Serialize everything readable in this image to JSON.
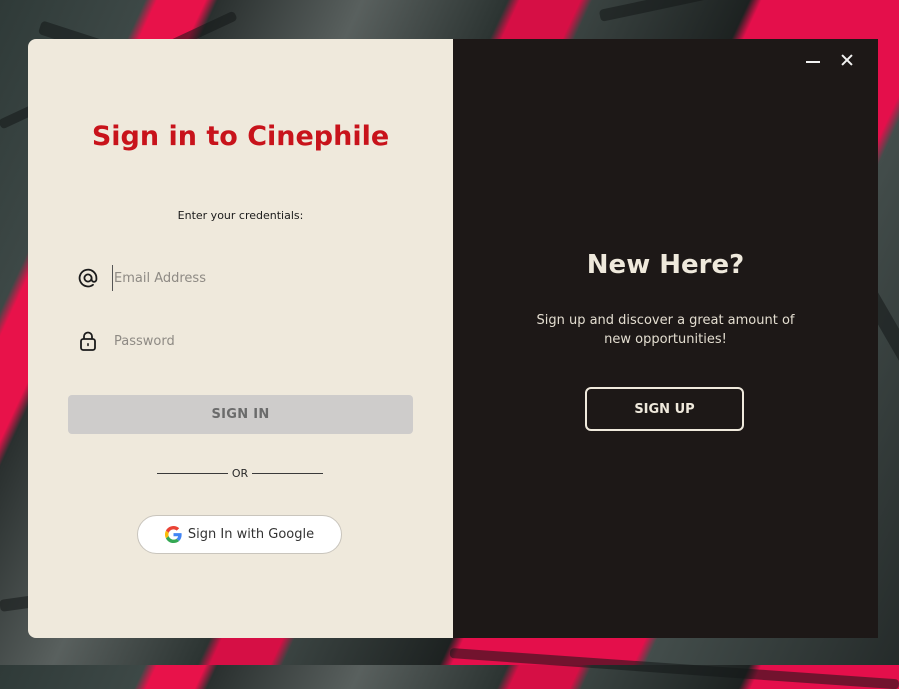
{
  "login": {
    "title": "Sign in to Cinephile",
    "subtitle": "Enter your credentials:",
    "email_placeholder": "Email Address",
    "password_placeholder": "Password",
    "email_icon": "at-icon",
    "password_icon": "lock-icon",
    "signin_label": "SIGN IN",
    "or_label": "OR",
    "google_label": "Sign In with Google",
    "google_icon": "google-icon"
  },
  "signup": {
    "title": "New Here?",
    "description": "Sign up and discover a great amount of new opportunities!",
    "signup_label": "SIGN UP"
  },
  "window_controls": {
    "minimize_icon": "minimize-icon",
    "close_icon": "close-icon"
  },
  "colors": {
    "accent_red": "#c8131b",
    "left_panel_bg": "#efe9dc",
    "right_panel_bg": "#1d1817",
    "signin_button_bg": "#cecccb"
  }
}
